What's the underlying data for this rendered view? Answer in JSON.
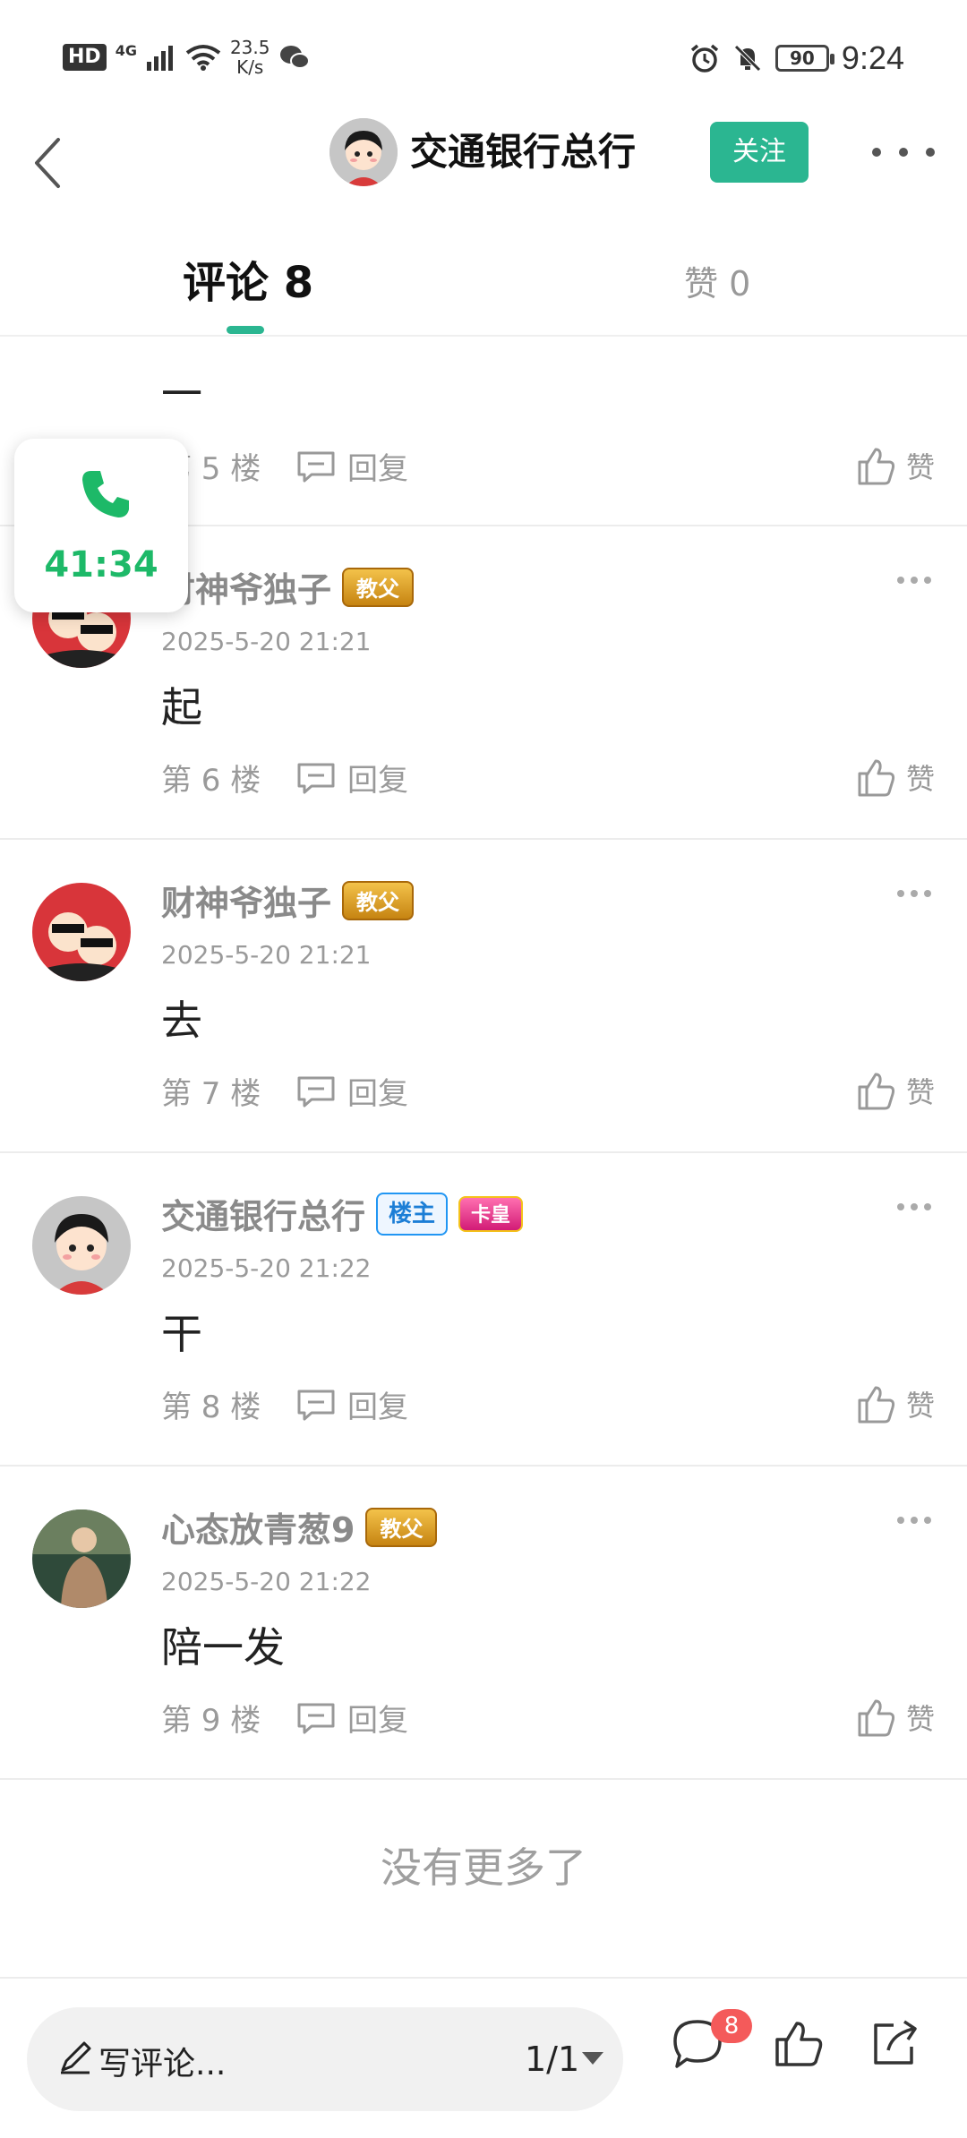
{
  "status_bar": {
    "hd": "HD",
    "network": "4G",
    "speed_value": "23.5",
    "speed_unit": "K/s",
    "battery": "90",
    "time": "9:24"
  },
  "header": {
    "title": "交通银行总行",
    "follow_label": "关注"
  },
  "tabs": {
    "comments_label": "评论 8",
    "likes_label": "赞 0"
  },
  "call_widget": {
    "duration": "41:34"
  },
  "comments": [
    {
      "name": "",
      "badge": "",
      "date": "",
      "text": "一",
      "floor": "第 5 楼",
      "reply": "回复",
      "like": "赞"
    },
    {
      "name": "财神爷独子",
      "badge": "教父",
      "date": "2025-5-20 21:21",
      "text": "起",
      "floor": "第 6 楼",
      "reply": "回复",
      "like": "赞"
    },
    {
      "name": "财神爷独子",
      "badge": "教父",
      "date": "2025-5-20 21:21",
      "text": "去",
      "floor": "第 7 楼",
      "reply": "回复",
      "like": "赞"
    },
    {
      "name": "交通银行总行",
      "owner_badge": "楼主",
      "badge": "卡皇",
      "date": "2025-5-20 21:22",
      "text": "干",
      "floor": "第 8 楼",
      "reply": "回复",
      "like": "赞"
    },
    {
      "name": "心态放青葱9",
      "badge": "教父",
      "date": "2025-5-20 21:22",
      "text": "陪一发",
      "floor": "第 9 楼",
      "reply": "回复",
      "like": "赞"
    }
  ],
  "no_more": "没有更多了",
  "bottom_bar": {
    "write_placeholder": "写评论...",
    "page": "1/1",
    "comment_count": "8"
  },
  "colors": {
    "accent": "#2bb691",
    "call_green": "#1db968",
    "badge_red": "#f45a5a"
  }
}
